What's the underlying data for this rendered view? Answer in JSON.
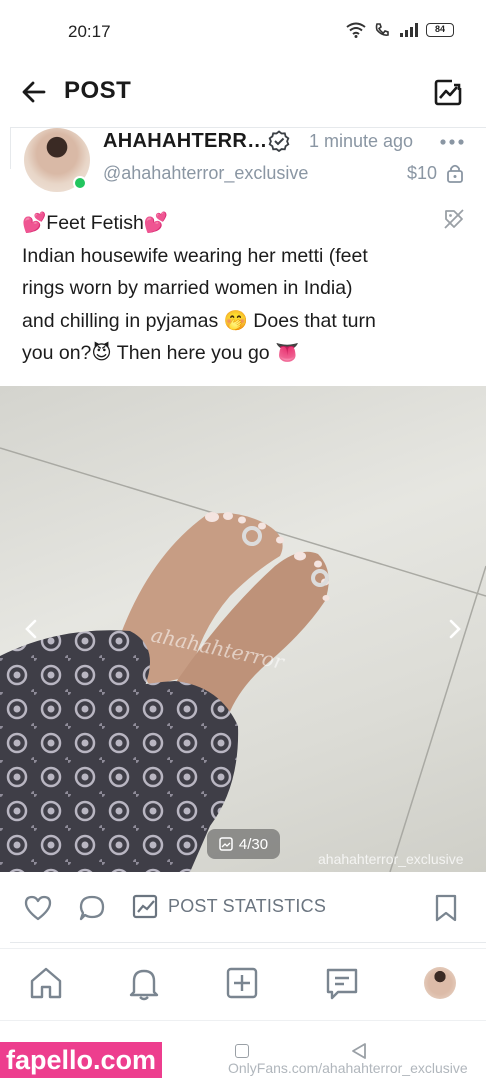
{
  "status_bar": {
    "time": "20:17",
    "battery": "84"
  },
  "header": {
    "title": "POST"
  },
  "author": {
    "name": "AHAHAHTERR…",
    "handle": "@ahahahterror_exclusive",
    "time_ago": "1 minute ago",
    "price": "$10",
    "online": true
  },
  "post": {
    "lines": [
      "💕Feet Fetish💕",
      "Indian housewife wearing her metti (feet",
      "rings worn by married women in India)",
      "and chilling in pyjamas 🤭 Does that turn",
      "you on?😈 Then here you go 👅"
    ]
  },
  "media": {
    "counter": "4/30",
    "watermark": "ahahahterror_exclusive",
    "image_watermark": "ahahahterror"
  },
  "actions": {
    "stats_label": "POST STATISTICS"
  },
  "footer": {
    "site_badge": "fapello.com",
    "url": "OnlyFans.com/ahahahterror_exclusive"
  },
  "colors": {
    "accent": "#00aff0",
    "muted": "#8a96a3",
    "online": "#22c55e",
    "badge": "#ed3e8e"
  },
  "icons": [
    "back-arrow-icon",
    "stats-icon",
    "verified-icon",
    "more-icon",
    "lock-icon",
    "tag-icon",
    "chevron-left-icon",
    "chevron-right-icon",
    "image-icon",
    "heart-icon",
    "comment-icon",
    "stats-icon",
    "bookmark-icon",
    "home-icon",
    "bell-icon",
    "plus-square-icon",
    "message-icon"
  ]
}
